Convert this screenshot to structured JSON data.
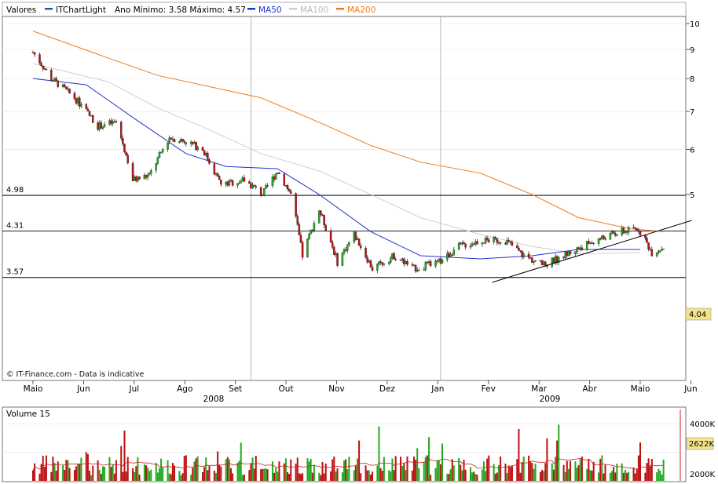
{
  "header": {
    "label": "Valores",
    "series_name": "ITChartLight",
    "range_text": "Ano Mínimo: 3.58 Máximo: 4.57",
    "ma50": "MA50",
    "ma100": "MA100",
    "ma200": "MA200"
  },
  "colors": {
    "up": "#22aa22",
    "down": "#bb1111",
    "ma50": "#2233cc",
    "ma100": "#cfcfcf",
    "ma200": "#f07a1a",
    "frame": "#333333",
    "grid": "#e2e2e2",
    "current_box": "#f5e38a"
  },
  "watermark": "© IT-Finance.com - Data is indicative",
  "price_panel": {
    "y_ticks": [
      "10",
      "9",
      "8",
      "7",
      "6",
      "5"
    ],
    "levels": [
      {
        "value": 4.98,
        "label": "4.98"
      },
      {
        "value": 4.31,
        "label": "4.31"
      },
      {
        "value": 3.57,
        "label": "3.57"
      }
    ],
    "current_label": "4.04"
  },
  "time_axis": {
    "months": [
      "Maio",
      "Jun",
      "Jul",
      "Ago",
      "Set",
      "Out",
      "Nov",
      "Dez",
      "Jan",
      "Fev",
      "Mar",
      "Abr",
      "Maio",
      "Jun"
    ],
    "years": [
      "2008",
      "2009"
    ]
  },
  "volume_panel": {
    "title": "Volume 15",
    "y_ticks": [
      "4000K",
      "2000K"
    ],
    "current_label": "2622K"
  },
  "chart_data": {
    "type": "candlestick",
    "scale": "log",
    "period": "2008-05 to 2009-05",
    "x_axis": [
      "2008-05",
      "2008-06",
      "2008-07",
      "2008-08",
      "2008-09",
      "2008-10",
      "2008-11",
      "2008-12",
      "2009-01",
      "2009-02",
      "2009-03",
      "2009-04",
      "2009-05"
    ],
    "close_approx": [
      {
        "date": "2008-05-01",
        "value": 8.9
      },
      {
        "date": "2008-05-12",
        "value": 8.0
      },
      {
        "date": "2008-05-26",
        "value": 7.4
      },
      {
        "date": "2008-06-09",
        "value": 6.6
      },
      {
        "date": "2008-06-20",
        "value": 6.7
      },
      {
        "date": "2008-06-30",
        "value": 5.3
      },
      {
        "date": "2008-07-10",
        "value": 5.4
      },
      {
        "date": "2008-07-22",
        "value": 6.3
      },
      {
        "date": "2008-08-01",
        "value": 6.2
      },
      {
        "date": "2008-08-11",
        "value": 6.0
      },
      {
        "date": "2008-08-22",
        "value": 5.2
      },
      {
        "date": "2008-09-05",
        "value": 5.3
      },
      {
        "date": "2008-09-16",
        "value": 5.0
      },
      {
        "date": "2008-09-25",
        "value": 5.5
      },
      {
        "date": "2008-10-03",
        "value": 5.0
      },
      {
        "date": "2008-10-10",
        "value": 3.9
      },
      {
        "date": "2008-10-20",
        "value": 4.7
      },
      {
        "date": "2008-10-31",
        "value": 3.8
      },
      {
        "date": "2008-11-10",
        "value": 4.25
      },
      {
        "date": "2008-11-21",
        "value": 3.7
      },
      {
        "date": "2008-12-04",
        "value": 3.9
      },
      {
        "date": "2008-12-16",
        "value": 3.7
      },
      {
        "date": "2008-12-31",
        "value": 3.8
      },
      {
        "date": "2009-01-12",
        "value": 4.05
      },
      {
        "date": "2009-01-26",
        "value": 4.15
      },
      {
        "date": "2009-02-09",
        "value": 4.15
      },
      {
        "date": "2009-02-20",
        "value": 3.9
      },
      {
        "date": "2009-03-04",
        "value": 3.75
      },
      {
        "date": "2009-03-16",
        "value": 3.9
      },
      {
        "date": "2009-03-27",
        "value": 4.05
      },
      {
        "date": "2009-04-09",
        "value": 4.2
      },
      {
        "date": "2009-04-20",
        "value": 4.3
      },
      {
        "date": "2009-04-30",
        "value": 4.35
      },
      {
        "date": "2009-05-08",
        "value": 3.95
      },
      {
        "date": "2009-05-15",
        "value": 4.04
      }
    ],
    "ma50": [
      {
        "date": "2008-05-01",
        "value": 8.0
      },
      {
        "date": "2008-06-02",
        "value": 7.8
      },
      {
        "date": "2008-07-01",
        "value": 6.8
      },
      {
        "date": "2008-08-01",
        "value": 5.9
      },
      {
        "date": "2008-08-25",
        "value": 5.6
      },
      {
        "date": "2008-09-25",
        "value": 5.55
      },
      {
        "date": "2008-10-20",
        "value": 5.0
      },
      {
        "date": "2008-11-20",
        "value": 4.3
      },
      {
        "date": "2008-12-20",
        "value": 3.9
      },
      {
        "date": "2009-01-25",
        "value": 3.85
      },
      {
        "date": "2009-02-25",
        "value": 3.9
      },
      {
        "date": "2009-03-25",
        "value": 4.0
      },
      {
        "date": "2009-05-01",
        "value": 4.0
      }
    ],
    "ma100": [
      {
        "date": "2008-05-01",
        "value": 8.5
      },
      {
        "date": "2008-06-15",
        "value": 7.9
      },
      {
        "date": "2008-07-15",
        "value": 7.1
      },
      {
        "date": "2008-08-15",
        "value": 6.5
      },
      {
        "date": "2008-09-15",
        "value": 5.9
      },
      {
        "date": "2008-10-20",
        "value": 5.5
      },
      {
        "date": "2008-11-20",
        "value": 5.0
      },
      {
        "date": "2008-12-20",
        "value": 4.55
      },
      {
        "date": "2009-01-25",
        "value": 4.25
      },
      {
        "date": "2009-02-25",
        "value": 4.05
      },
      {
        "date": "2009-03-25",
        "value": 3.93
      },
      {
        "date": "2009-05-01",
        "value": 3.95
      }
    ],
    "ma200": [
      {
        "date": "2008-05-01",
        "value": 9.7
      },
      {
        "date": "2008-06-15",
        "value": 8.7
      },
      {
        "date": "2008-07-15",
        "value": 8.1
      },
      {
        "date": "2008-09-15",
        "value": 7.4
      },
      {
        "date": "2008-10-20",
        "value": 6.7
      },
      {
        "date": "2008-11-20",
        "value": 6.1
      },
      {
        "date": "2008-12-20",
        "value": 5.7
      },
      {
        "date": "2009-01-25",
        "value": 5.45
      },
      {
        "date": "2009-02-25",
        "value": 5.0
      },
      {
        "date": "2009-03-25",
        "value": 4.55
      },
      {
        "date": "2009-04-25",
        "value": 4.35
      },
      {
        "date": "2009-05-15",
        "value": 4.3
      }
    ],
    "trendline": [
      {
        "date": "2009-02-01",
        "value": 3.5
      },
      {
        "date": "2009-06-01",
        "value": 4.5
      }
    ],
    "volume_ylim_k": [
      0,
      5000
    ]
  }
}
